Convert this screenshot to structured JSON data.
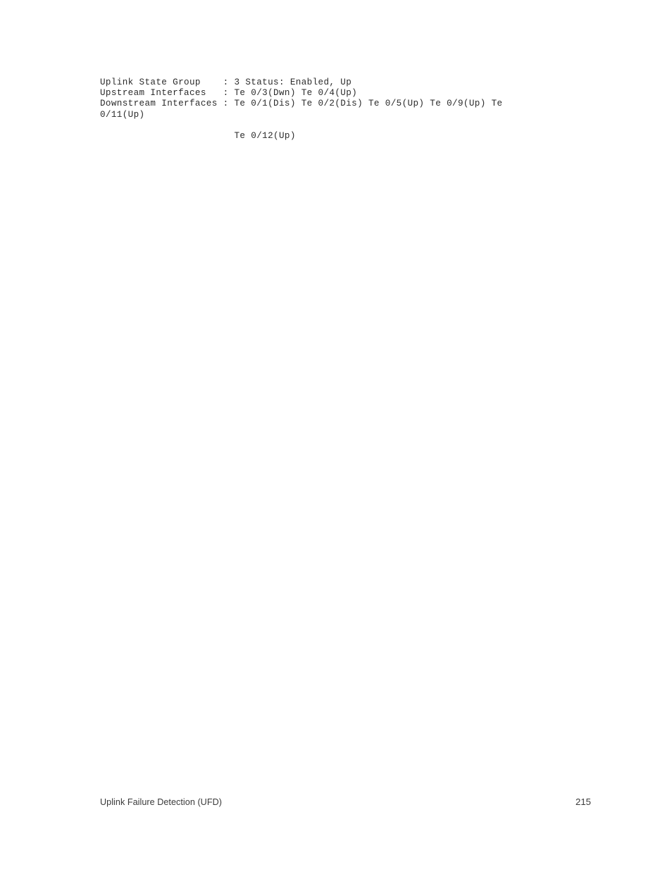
{
  "document": {
    "page_number": "215",
    "footer_title": "Uplink Failure Detection (UFD)"
  },
  "cli_output": {
    "lines": [
      "Uplink State Group    : 3 Status: Enabled, Up",
      "Upstream Interfaces   : Te 0/3(Dwn) Te 0/4(Up)",
      "Downstream Interfaces : Te 0/1(Dis) Te 0/2(Dis) Te 0/5(Up) Te 0/9(Up) Te",
      "0/11(Up)",
      "                        Te 0/12(Up)"
    ],
    "fields": {
      "uplink_state_group_label": "Uplink State Group",
      "uplink_state_group_value": "3 Status: Enabled, Up",
      "upstream_interfaces_label": "Upstream Interfaces",
      "upstream_interfaces_value": "Te 0/3(Dwn) Te 0/4(Up)",
      "downstream_interfaces_label": "Downstream Interfaces",
      "downstream_interfaces_value": "Te 0/1(Dis) Te 0/2(Dis) Te 0/5(Up) Te 0/9(Up) Te 0/11(Up) Te 0/12(Up)"
    },
    "interfaces": {
      "upstream": [
        {
          "name": "Te 0/3",
          "state": "Dwn"
        },
        {
          "name": "Te 0/4",
          "state": "Up"
        }
      ],
      "downstream": [
        {
          "name": "Te 0/1",
          "state": "Dis"
        },
        {
          "name": "Te 0/2",
          "state": "Dis"
        },
        {
          "name": "Te 0/5",
          "state": "Up"
        },
        {
          "name": "Te 0/9",
          "state": "Up"
        },
        {
          "name": "Te 0/11",
          "state": "Up"
        },
        {
          "name": "Te 0/12",
          "state": "Up"
        }
      ]
    }
  },
  "colors": {
    "page_background": "#ffffff",
    "cli_text": "#2b2b2b",
    "footer_text": "#3a3a3a"
  }
}
